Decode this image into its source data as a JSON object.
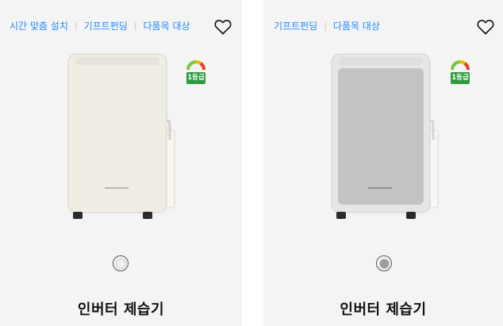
{
  "cards": [
    {
      "tags": [
        "시간 맞춤 설치",
        "기프트펀딩",
        "다품목 대상"
      ],
      "title": "인버터 제습기",
      "energy_label": "1등급",
      "color_swatch": "#f1f0ea",
      "product_body_color": "#efede4"
    },
    {
      "tags": [
        "기프트펀딩",
        "다품목 대상"
      ],
      "title": "인버터 제습기",
      "energy_label": "1등급",
      "color_swatch": "#9c9c9c",
      "product_body_color": "#c3c3c1"
    }
  ],
  "icons": {
    "wishlist": "heart-outline-icon",
    "energy": "energy-efficiency-grade-icon"
  },
  "colors": {
    "tag_link": "#2189ff",
    "card_bg": "#f4f4f4",
    "energy_green": "#2e9b3e"
  }
}
